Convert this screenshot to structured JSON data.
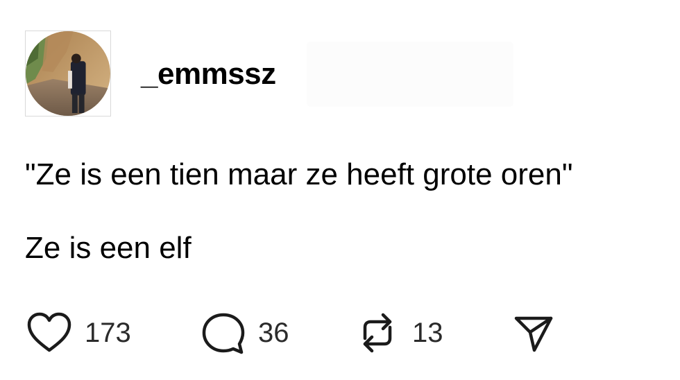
{
  "post": {
    "username": "_emmssz",
    "lines": [
      "\"Ze is een tien maar ze heeft grote oren\"",
      "Ze is een elf"
    ]
  },
  "actions": {
    "likes": "173",
    "comments": "36",
    "reposts": "13"
  },
  "icons": {
    "like": "heart-icon",
    "comment": "comment-bubble-icon",
    "repost": "repost-icon",
    "share": "send-icon"
  }
}
